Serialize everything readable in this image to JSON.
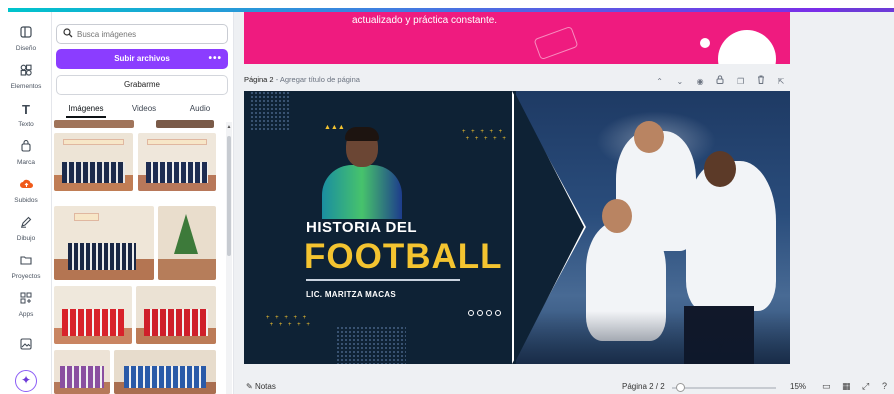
{
  "rail": {
    "items": [
      {
        "label": "Diseño",
        "icon": "layout-icon"
      },
      {
        "label": "Elementos",
        "icon": "shapes-icon"
      },
      {
        "label": "Texto",
        "icon": "text-icon"
      },
      {
        "label": "Marca",
        "icon": "brand-icon"
      },
      {
        "label": "Subidos",
        "icon": "cloud-upload-icon"
      },
      {
        "label": "Dibujo",
        "icon": "pen-icon"
      },
      {
        "label": "Proyectos",
        "icon": "folder-icon"
      },
      {
        "label": "Apps",
        "icon": "apps-icon"
      },
      {
        "label": "",
        "icon": "image-icon"
      }
    ]
  },
  "panel": {
    "search_placeholder": "Busca imágenes",
    "upload_label": "Subir archivos",
    "upload_more": "•••",
    "record_label": "Grabarme",
    "tabs": [
      "Imágenes",
      "Videos",
      "Audio"
    ],
    "active_tab": "Imágenes"
  },
  "canvas": {
    "prev_page_text": "actualizado y práctica constante.",
    "page_label": "Página 2",
    "page_title_placeholder": "- Agregar título de página",
    "slide": {
      "title_small": "HISTORIA DEL",
      "title_big": "FOOTBALL",
      "author": "LIC. MARITZA MACAS"
    }
  },
  "bottom": {
    "notes_label": "Notas",
    "page_indicator": "Página 2 / 2",
    "zoom": "15%"
  },
  "colors": {
    "accent": "#8b3dff",
    "pink": "#ef1b7f",
    "gold": "#f4c430",
    "navy": "#0e2235"
  }
}
